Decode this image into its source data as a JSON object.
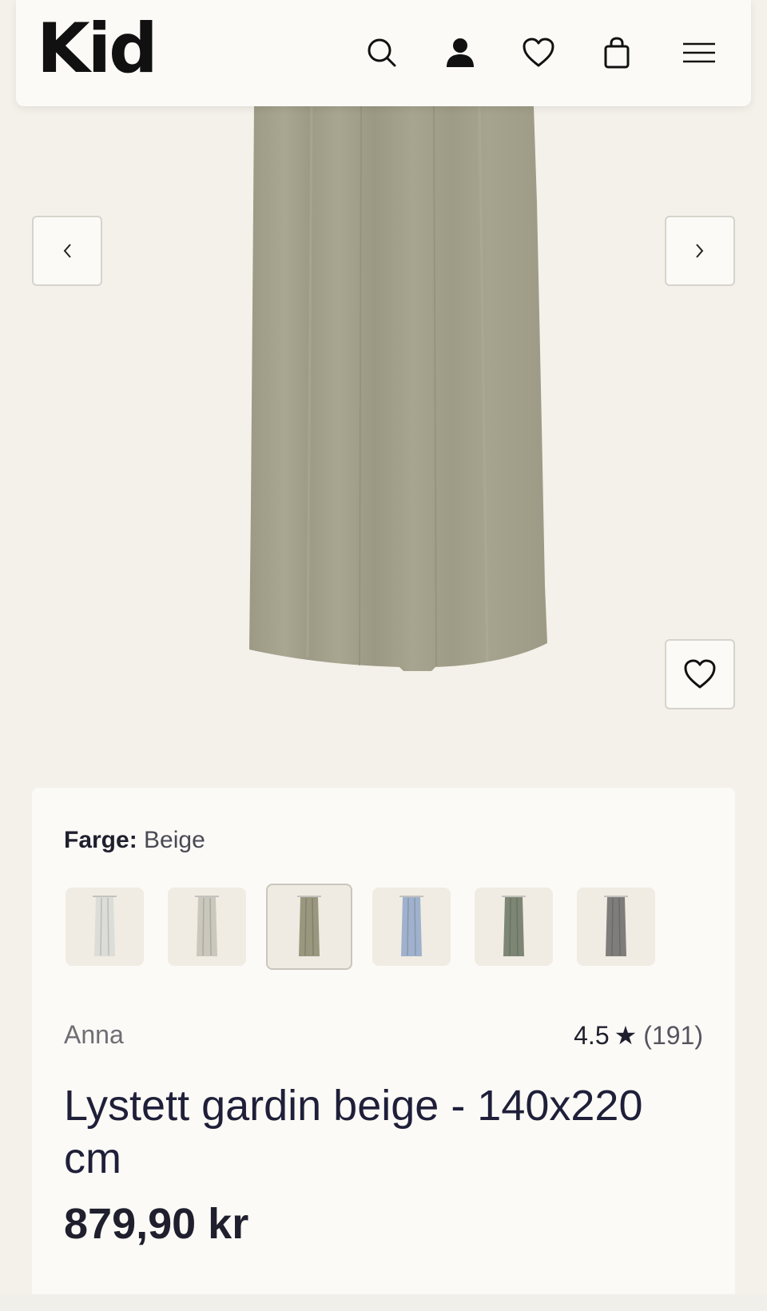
{
  "header": {
    "logo": "Kid",
    "icons": [
      "search-icon",
      "account-icon",
      "wishlist-icon",
      "cart-icon",
      "menu-icon"
    ]
  },
  "gallery": {
    "prev_label": "‹",
    "next_label": "›",
    "curtain_color": "#a3a08c"
  },
  "product": {
    "color_label": "Farge:",
    "color_value": "Beige",
    "swatches": [
      {
        "color": "#dcdcd8",
        "selected": false
      },
      {
        "color": "#cac7bd",
        "selected": false
      },
      {
        "color": "#9a977f",
        "selected": true
      },
      {
        "color": "#9fb1cc",
        "selected": false
      },
      {
        "color": "#7d8674",
        "selected": false
      },
      {
        "color": "#7f7d7b",
        "selected": false
      }
    ],
    "brand": "Anna",
    "rating": "4.5",
    "review_count": "(191)",
    "title": "Lystett gardin beige - 140x220 cm",
    "price": "879,90 kr"
  }
}
